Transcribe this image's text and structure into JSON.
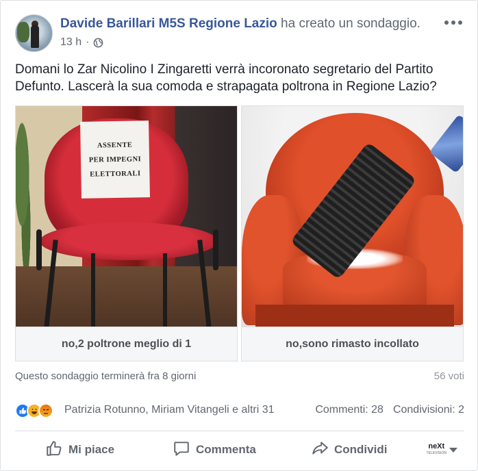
{
  "post": {
    "author": "Davide Barillari M5S Regione Lazio",
    "action": " ha creato un sondaggio.",
    "time": "13 h",
    "time_separator": "·",
    "text": "Domani lo Zar Nicolino I Zingaretti verrà incoronato segretario del Partito Defunto. Lascerà la sua comoda e strapagata poltrona in Regione Lazio?",
    "privacy_icon": "globe-icon",
    "menu_icon": "more-icon"
  },
  "poll": {
    "options": [
      {
        "label": "no,2 poltrone meglio di 1",
        "image_sign": [
          "ASSENTE",
          "PER IMPEGNI",
          "ELETTORALI"
        ]
      },
      {
        "label": "no,sono rimasto incollato"
      }
    ],
    "ends_text": "Questo sondaggio terminerà fra 8 giorni",
    "votes_text": "56 voti"
  },
  "reactions": {
    "icons": [
      "like-icon",
      "haha-icon",
      "angry-icon"
    ],
    "names": "Patrizia Rotunno, Miriam Vitangeli e altri 31",
    "comments": "Commenti: 28",
    "shares": "Condivisioni: 2"
  },
  "actions": {
    "like": "Mi piace",
    "comment": "Commenta",
    "share": "Condividi",
    "page_logo": "neXt",
    "page_logo_sub": "TELEVISION"
  },
  "colors": {
    "link": "#385898",
    "secondary_text": "#606770",
    "like_blue": "#2078f4"
  }
}
